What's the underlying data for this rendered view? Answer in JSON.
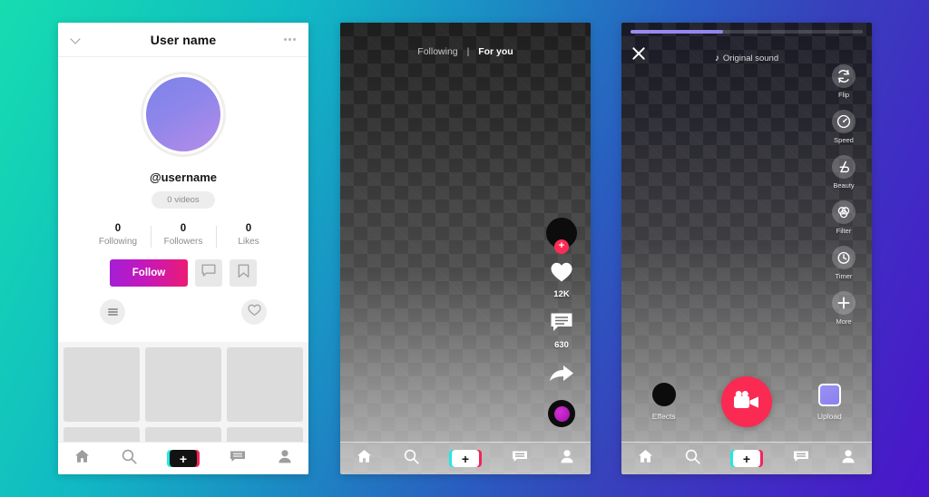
{
  "background": {
    "from": "#17dcb0",
    "to": "#4a15c9"
  },
  "profile_screen": {
    "header": {
      "title": "User name",
      "back_icon": "chevron-down-icon",
      "more_icon": "more-dots-icon"
    },
    "avatar": {
      "gradient_from": "#7c83e9",
      "gradient_to": "#b68ce9"
    },
    "handle": "@username",
    "videos_badge": "0 videos",
    "stats": [
      {
        "value": "0",
        "label": "Following"
      },
      {
        "value": "0",
        "label": "Followers"
      },
      {
        "value": "0",
        "label": "Likes"
      }
    ],
    "follow_button": {
      "label": "Follow",
      "gradient_from": "#a51ed4",
      "gradient_to": "#ec1a75"
    },
    "message_icon": "comment-icon",
    "bookmark_icon": "bookmark-icon",
    "menu_icon": "hamburger-icon",
    "likes_icon": "heart-icon",
    "grid_tiles": 9,
    "nav": [
      {
        "icon": "home-icon",
        "label": "Home"
      },
      {
        "icon": "search-icon",
        "label": "Discover"
      },
      {
        "icon": "plus-icon",
        "label": "+"
      },
      {
        "icon": "inbox-icon",
        "label": "Inbox"
      },
      {
        "icon": "profile-icon",
        "label": "Me"
      }
    ]
  },
  "feed_screen": {
    "tabs": {
      "following": "Following",
      "separator": "|",
      "for_you": "For you"
    },
    "rail": {
      "avatar_badge": "+",
      "like_icon": "heart-icon",
      "like_count": "12K",
      "comment_icon": "comment-icon",
      "comment_count": "630",
      "share_icon": "share-arrow-icon",
      "music_disc_icon": "music-disc-icon"
    },
    "nav": [
      {
        "icon": "home-icon",
        "label": "Home"
      },
      {
        "icon": "search-icon",
        "label": "Discover"
      },
      {
        "icon": "plus-icon",
        "label": "+"
      },
      {
        "icon": "inbox-icon",
        "label": "Inbox"
      },
      {
        "icon": "profile-icon",
        "label": "Me"
      }
    ]
  },
  "camera_screen": {
    "progress_percent": 40,
    "progress_color": "#9b8cf0",
    "close_icon": "close-icon",
    "sound": {
      "icon": "music-note-icon",
      "label": "Original sound"
    },
    "tools": [
      {
        "icon": "flip-camera-icon",
        "label": "Flip"
      },
      {
        "icon": "speed-icon",
        "label": "Speed"
      },
      {
        "icon": "beauty-icon",
        "label": "Beauty"
      },
      {
        "icon": "filter-icon",
        "label": "Filter"
      },
      {
        "icon": "timer-icon",
        "label": "Timer"
      },
      {
        "icon": "plus-icon",
        "label": "More"
      }
    ],
    "effects": {
      "icon": "effects-icon",
      "label": "Effects"
    },
    "record": {
      "icon": "video-camera-icon",
      "color": "#fa2a52"
    },
    "upload": {
      "icon": "upload-thumbnail-icon",
      "label": "Upload"
    },
    "nav": [
      {
        "icon": "home-icon",
        "label": "Home"
      },
      {
        "icon": "search-icon",
        "label": "Discover"
      },
      {
        "icon": "plus-icon",
        "label": "+"
      },
      {
        "icon": "inbox-icon",
        "label": "Inbox"
      },
      {
        "icon": "profile-icon",
        "label": "Me"
      }
    ]
  }
}
